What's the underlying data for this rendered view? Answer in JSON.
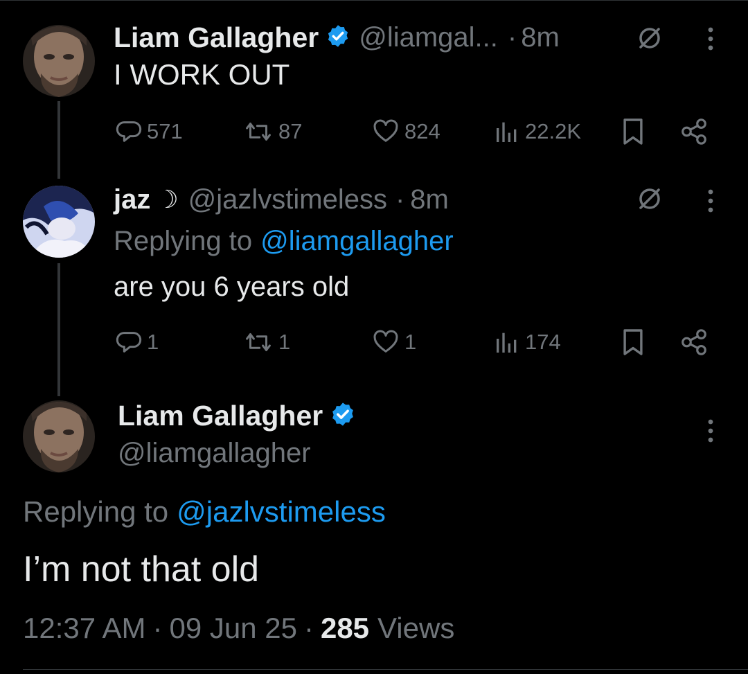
{
  "colors": {
    "background": "#000000",
    "text": "#e7e9ea",
    "muted": "#71767b",
    "link": "#1d9bf0",
    "verified": "#1d9bf0"
  },
  "tweet1": {
    "name": "Liam Gallagher",
    "handle": "@liamgal...",
    "separator": "·",
    "time": "8m",
    "text": "I WORK OUT",
    "replies": "571",
    "retweets": "87",
    "likes": "824",
    "views": "22.2K",
    "icons": [
      "verified-badge-icon",
      "reply-restricted-icon",
      "more-icon",
      "reply-icon",
      "retweet-icon",
      "like-icon",
      "views-icon",
      "bookmark-icon",
      "share-icon"
    ]
  },
  "tweet2": {
    "name": "jaz",
    "name_symbol": "☽",
    "handle": "@jazlvstimeless",
    "separator": "·",
    "time": "8m",
    "replying_prefix": "Replying to",
    "replying_handle": "@liamgallagher",
    "text": "are you 6 years old",
    "replies": "1",
    "retweets": "1",
    "likes": "1",
    "views": "174"
  },
  "tweet3": {
    "name": "Liam Gallagher",
    "handle": "@liamgallagher",
    "replying_prefix": "Replying to",
    "replying_handle": "@jazlvstimeless",
    "text": "I’m not that old",
    "time": "12:37 AM",
    "sep1": "·",
    "date": "09 Jun 25",
    "sep2": "·",
    "views_count": "285",
    "views_label": "Views"
  }
}
